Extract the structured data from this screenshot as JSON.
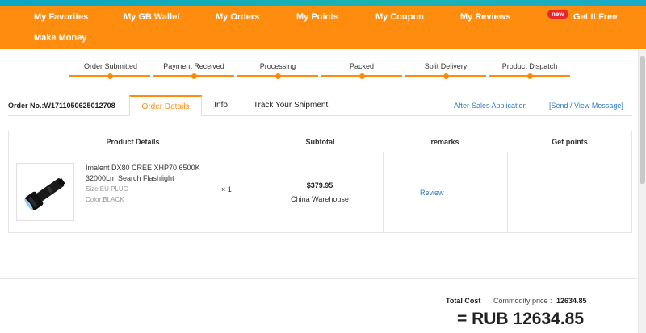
{
  "nav": {
    "items": [
      "My Favorites",
      "My GB Wallet",
      "My Orders",
      "My Points",
      "My Coupon",
      "My Reviews",
      "Get It Free",
      "Make Money"
    ],
    "new_badge": "new"
  },
  "progress": {
    "steps": [
      "Order Submitted",
      "Payment Received",
      "Processing",
      "Packed",
      "Split Delivery",
      "Product Dispatch"
    ]
  },
  "order": {
    "number_label": "Order No.:W1711050625012708",
    "tabs": [
      "Order Details",
      "Info.",
      "Track Your Shipment"
    ],
    "after_sales": "After-Sales Application",
    "message": "[Send / View Message]"
  },
  "table": {
    "headers": [
      "Product Details",
      "Subtotal",
      "remarks",
      "Get points"
    ],
    "product": {
      "name": "Imalent DX80 CREE XHP70 6500K 32000Lm Search Flashlight",
      "size": "Size:EU PLUG",
      "color": "Color:BLACK",
      "qty": "× 1",
      "price": "$379.95",
      "warehouse": "China Warehouse",
      "remark_link": "Review"
    }
  },
  "totals": {
    "total_cost_label": "Total Cost",
    "commodity_label": "Commodity price :",
    "commodity_value": "12634.85",
    "grand_total": "= RUB 12634.85"
  },
  "colors": {
    "accent": "#fe8d0f",
    "link": "#2c7bc0",
    "top_strip": "#0aa6c4"
  }
}
